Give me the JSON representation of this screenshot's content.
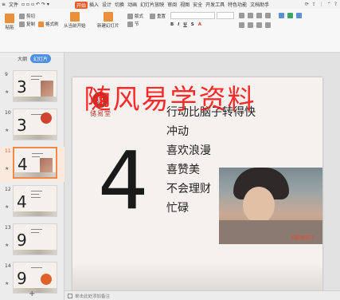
{
  "menubar": {
    "file_label": "文件",
    "tabs": [
      "开始",
      "插入",
      "设计",
      "切换",
      "动画",
      "幻灯片放映",
      "审阅",
      "视图",
      "安全",
      "开发工具",
      "特色功能",
      "文档助手"
    ],
    "active_tab_index": 0
  },
  "ribbon": {
    "cut": "剪切",
    "copy": "复制",
    "format_painter": "格式刷",
    "paste": "粘贴",
    "start_from_current": "从当前开始",
    "new_slide": "新建幻灯片",
    "layout": "版式",
    "section": "节",
    "reset": "重置"
  },
  "leftpanel": {
    "tabs": [
      "大纲",
      "幻灯片"
    ],
    "active_tab_index": 1,
    "slides": [
      {
        "num": "9",
        "big": "3"
      },
      {
        "num": "10",
        "big": "3"
      },
      {
        "num": "11",
        "big": "4"
      },
      {
        "num": "12",
        "big": "4"
      },
      {
        "num": "13",
        "big": "9"
      },
      {
        "num": "14",
        "big": "9"
      }
    ],
    "selected_index": 2,
    "add_label": "+"
  },
  "slide": {
    "seal_char": "易",
    "brand": "储易堂",
    "big_number": "4",
    "lines": [
      "行动比脑子转得快",
      "冲动",
      "喜欢浪漫",
      "喜赞美",
      "不会理财",
      "忙碌"
    ],
    "photo_caption": "如影随形王"
  },
  "watermark": "随风易学资料",
  "statusbar": {
    "notes_placeholder": "单击此处添加备注"
  },
  "colors": {
    "accent": "#e85c2c",
    "watermark": "#ff1a1a",
    "selection": "#f08a4b",
    "seal": "#b8392d"
  }
}
